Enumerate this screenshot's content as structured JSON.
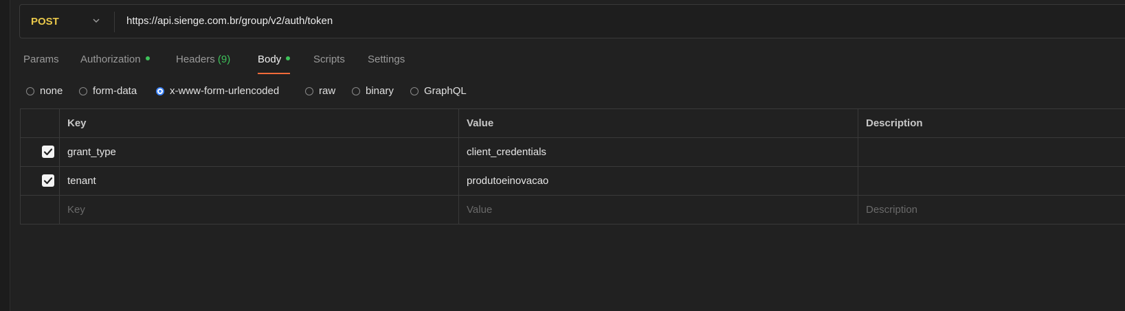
{
  "request": {
    "method": "POST",
    "url": "https://api.sienge.com.br/group/v2/auth/token"
  },
  "tabs": [
    {
      "label": "Params",
      "active": false
    },
    {
      "label": "Authorization",
      "active": false,
      "dot": true
    },
    {
      "label": "Headers",
      "count": "(9)",
      "active": false
    },
    {
      "label": "Body",
      "active": true,
      "dot": true
    },
    {
      "label": "Scripts",
      "active": false
    },
    {
      "label": "Settings",
      "active": false
    }
  ],
  "body_types": [
    {
      "label": "none",
      "selected": false
    },
    {
      "label": "form-data",
      "selected": false
    },
    {
      "label": "x-www-form-urlencoded",
      "selected": true
    },
    {
      "label": "raw",
      "selected": false
    },
    {
      "label": "binary",
      "selected": false
    },
    {
      "label": "GraphQL",
      "selected": false
    }
  ],
  "table": {
    "headers": {
      "key": "Key",
      "value": "Value",
      "description": "Description"
    },
    "rows": [
      {
        "checked": true,
        "key": "grant_type",
        "value": "client_credentials",
        "description": ""
      },
      {
        "checked": true,
        "key": "tenant",
        "value": "produtoeinovacao",
        "description": ""
      }
    ],
    "placeholders": {
      "key": "Key",
      "value": "Value",
      "description": "Description"
    }
  },
  "colors": {
    "method": "#e8c74a",
    "accent_underline": "#f26b3a",
    "status_dot": "#3ec25a",
    "radio_selected": "#3b82f6"
  }
}
